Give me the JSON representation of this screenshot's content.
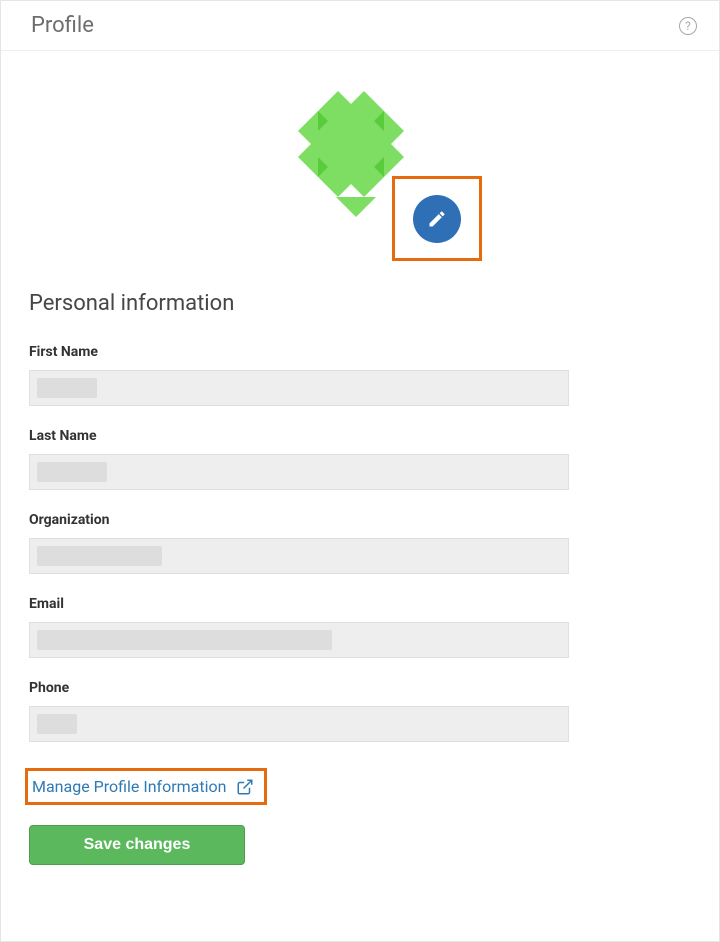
{
  "header": {
    "title": "Profile"
  },
  "section": {
    "heading": "Personal information"
  },
  "form": {
    "first_name": {
      "label": "First Name",
      "value": ""
    },
    "last_name": {
      "label": "Last Name",
      "value": ""
    },
    "organization": {
      "label": "Organization",
      "value": ""
    },
    "email": {
      "label": "Email",
      "value": ""
    },
    "phone": {
      "label": "Phone",
      "value": ""
    }
  },
  "links": {
    "manage_profile": "Manage Profile Information"
  },
  "buttons": {
    "save": "Save changes"
  },
  "colors": {
    "accent": "#2e6fb5",
    "highlight_border": "#e56b0e",
    "save_button": "#5cb85c",
    "avatar_green": "#7ede63"
  }
}
